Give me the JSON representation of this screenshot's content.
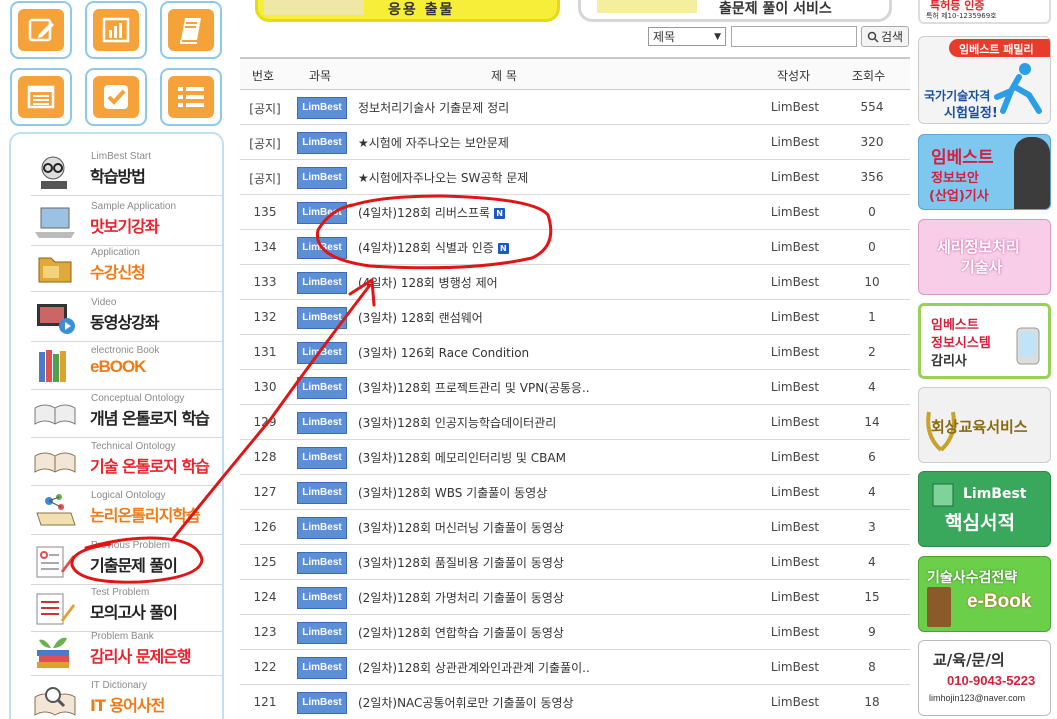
{
  "top_banners": {
    "left_text": "응용    출물",
    "right_text": "출문제 풀이 서비스"
  },
  "quick_tiles": [
    {
      "icon": "pencil-note-icon"
    },
    {
      "icon": "bar-chart-icon"
    },
    {
      "icon": "book-icon"
    },
    {
      "icon": "calendar-list-icon"
    },
    {
      "icon": "checkbox-icon"
    },
    {
      "icon": "bullet-list-icon"
    }
  ],
  "sidebar": {
    "items": [
      {
        "en": "LimBest Start",
        "ko": "학습방법",
        "color": "#222222",
        "icon": "student-glasses-icon"
      },
      {
        "en": "Sample Application",
        "ko": "맛보기강좌",
        "color": "#e8232d",
        "icon": "laptop-icon"
      },
      {
        "en": "Application",
        "ko": "수강신청",
        "color": "#f07a16",
        "icon": "folder-icon"
      },
      {
        "en": "Video",
        "ko": "동영상강좌",
        "color": "#222222",
        "icon": "video-monitor-icon"
      },
      {
        "en": "electronic Book",
        "ko": "eBOOK",
        "color": "#f07a16",
        "icon": "books-icon"
      },
      {
        "en": "Conceptual Ontology",
        "ko": "개념 온톨로지 학습",
        "color": "#222222",
        "icon": "open-book-icon"
      },
      {
        "en": "Technical Ontology",
        "ko": "기술 온톨로지 학습",
        "color": "#e8232d",
        "icon": "open-book-icon"
      },
      {
        "en": "Logical Ontology",
        "ko": "논리온톨리지학습",
        "color": "#f07a16",
        "icon": "molecule-book-icon"
      },
      {
        "en": "Previous Problem",
        "ko": "기출문제 풀이",
        "color": "#222222",
        "icon": "exam-paper-icon"
      },
      {
        "en": "Test Problem",
        "ko": "모의고사 풀이",
        "color": "#222222",
        "icon": "exam-pencil-icon"
      },
      {
        "en": "Problem Bank",
        "ko": "감리사 문제은행",
        "color": "#e8232d",
        "icon": "plant-books-icon"
      },
      {
        "en": "IT Dictionary",
        "ko": "IT 용어사전",
        "color": "#f07a16",
        "icon": "magnifier-book-icon"
      }
    ]
  },
  "search": {
    "field_selected": "제목",
    "query": "",
    "button_label": "검색"
  },
  "board": {
    "columns": [
      "번호",
      "과목",
      "제 목",
      "작성자",
      "조회수"
    ],
    "badge_label": "LimBest",
    "new_label": "N",
    "rows": [
      {
        "num": "[공지]",
        "title": "정보처리기술사 기출문제 정리",
        "author": "LimBest",
        "views": "554",
        "new": false
      },
      {
        "num": "[공지]",
        "title": "★시험에 자주나오는 보안문제",
        "author": "LimBest",
        "views": "320",
        "new": false
      },
      {
        "num": "[공지]",
        "title": "★시험에자주나오는 SW공학 문제",
        "author": "LimBest",
        "views": "356",
        "new": false
      },
      {
        "num": "135",
        "title": "(4일차)128회 리버스프록",
        "author": "LimBest",
        "views": "0",
        "new": true
      },
      {
        "num": "134",
        "title": "(4일차)128회 식별과 인증",
        "author": "LimBest",
        "views": "0",
        "new": true
      },
      {
        "num": "133",
        "title": "(4일차) 128회 병행성 제어",
        "author": "LimBest",
        "views": "10",
        "new": false
      },
      {
        "num": "132",
        "title": "(3일차) 128회 랜섬웨어",
        "author": "LimBest",
        "views": "1",
        "new": false
      },
      {
        "num": "131",
        "title": "(3일차) 126회 Race Condition",
        "author": "LimBest",
        "views": "2",
        "new": false
      },
      {
        "num": "130",
        "title": "(3일차)128회 프로젝트관리 및 VPN(공통응..",
        "author": "LimBest",
        "views": "4",
        "new": false
      },
      {
        "num": "129",
        "title": "(3일차)128회 인공지능학습데이터관리",
        "author": "LimBest",
        "views": "14",
        "new": false
      },
      {
        "num": "128",
        "title": "(3일차)128회 메모리인터리빙 및 CBAM",
        "author": "LimBest",
        "views": "6",
        "new": false
      },
      {
        "num": "127",
        "title": "(3일차)128회 WBS 기출풀이 동영상",
        "author": "LimBest",
        "views": "4",
        "new": false
      },
      {
        "num": "126",
        "title": "(3일차)128회 머신러닝 기출풀이 동영상",
        "author": "LimBest",
        "views": "3",
        "new": false
      },
      {
        "num": "125",
        "title": "(3일차)128회 품질비용 기출풀이 동영상",
        "author": "LimBest",
        "views": "4",
        "new": false
      },
      {
        "num": "124",
        "title": "(2일차)128회 가명처리 기출풀이 동영상",
        "author": "LimBest",
        "views": "15",
        "new": false
      },
      {
        "num": "123",
        "title": "(2일차)128회 연합학습 기출풀이 동영상",
        "author": "LimBest",
        "views": "9",
        "new": false
      },
      {
        "num": "122",
        "title": "(2일차)128회 상관관계와인과관계 기출풀이..",
        "author": "LimBest",
        "views": "8",
        "new": false
      },
      {
        "num": "121",
        "title": "(2일차)NAC공통어휘로만 기출풀이 동영상",
        "author": "LimBest",
        "views": "18",
        "new": false
      }
    ]
  },
  "right_banners": {
    "top_partial": {
      "line1": "특허등 인증",
      "line2": "특허 제10-1235969호"
    },
    "family": {
      "tag": "임베스트 패밀리",
      "line1": "국가기술자격",
      "line2": "시험일정!"
    },
    "security": {
      "line1": "임베스트",
      "line2": "정보보안",
      "line3": "(산업)기사"
    },
    "seri": {
      "line1": "세리정보처리",
      "line2": "기술사"
    },
    "audit": {
      "line1": "임베스트",
      "line2": "정보시스템",
      "line3": "감리사"
    },
    "service": {
      "line1": "회상교육서비스"
    },
    "book": {
      "line1": "LimBest",
      "line2": "핵심서적"
    },
    "ebook": {
      "line1": "기술사수검전략",
      "line2": "e-Book"
    },
    "contact": {
      "line1": "교/육/문/의",
      "phone": "010-9043-5223",
      "email": "limhojin123@naver.com"
    }
  },
  "colors": {
    "accent_orange": "#f6a23a",
    "tile_border": "#8cc9ea",
    "badge_blue": "#5c8fd6",
    "annotation_red": "#e01515"
  }
}
